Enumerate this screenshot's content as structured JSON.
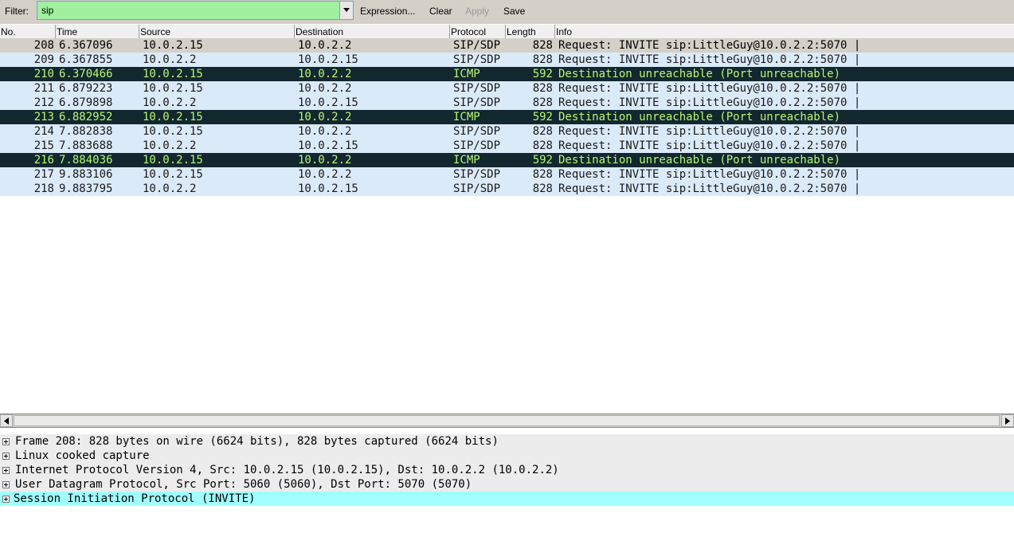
{
  "filter": {
    "label": "Filter:",
    "value": "sip",
    "expression_label": "Expression...",
    "clear_label": "Clear",
    "apply_label": "Apply",
    "save_label": "Save",
    "box_color": "#a0f0a0"
  },
  "columns": [
    "No.",
    "Time",
    "Source",
    "Destination",
    "Protocol",
    "Length",
    "Info"
  ],
  "packets": [
    {
      "no": "208",
      "time": "6.367096",
      "src": "10.0.2.15",
      "dst": "10.0.2.2",
      "proto": "SIP/SDP",
      "len": "828",
      "info": "Request: INVITE sip:LittleGuy@10.0.2.2:5070 |",
      "style": "selected"
    },
    {
      "no": "209",
      "time": "6.367855",
      "src": "10.0.2.2",
      "dst": "10.0.2.15",
      "proto": "SIP/SDP",
      "len": "828",
      "info": "Request: INVITE sip:LittleGuy@10.0.2.2:5070 |",
      "style": "sip"
    },
    {
      "no": "210",
      "time": "6.370466",
      "src": "10.0.2.15",
      "dst": "10.0.2.2",
      "proto": "ICMP",
      "len": "592",
      "info": "Destination unreachable (Port unreachable)",
      "style": "icmp"
    },
    {
      "no": "211",
      "time": "6.879223",
      "src": "10.0.2.15",
      "dst": "10.0.2.2",
      "proto": "SIP/SDP",
      "len": "828",
      "info": "Request: INVITE sip:LittleGuy@10.0.2.2:5070 |",
      "style": "sip"
    },
    {
      "no": "212",
      "time": "6.879898",
      "src": "10.0.2.2",
      "dst": "10.0.2.15",
      "proto": "SIP/SDP",
      "len": "828",
      "info": "Request: INVITE sip:LittleGuy@10.0.2.2:5070 |",
      "style": "sip"
    },
    {
      "no": "213",
      "time": "6.882952",
      "src": "10.0.2.15",
      "dst": "10.0.2.2",
      "proto": "ICMP",
      "len": "592",
      "info": "Destination unreachable (Port unreachable)",
      "style": "icmp"
    },
    {
      "no": "214",
      "time": "7.882838",
      "src": "10.0.2.15",
      "dst": "10.0.2.2",
      "proto": "SIP/SDP",
      "len": "828",
      "info": "Request: INVITE sip:LittleGuy@10.0.2.2:5070 |",
      "style": "sip"
    },
    {
      "no": "215",
      "time": "7.883688",
      "src": "10.0.2.2",
      "dst": "10.0.2.15",
      "proto": "SIP/SDP",
      "len": "828",
      "info": "Request: INVITE sip:LittleGuy@10.0.2.2:5070 |",
      "style": "sip"
    },
    {
      "no": "216",
      "time": "7.884036",
      "src": "10.0.2.15",
      "dst": "10.0.2.2",
      "proto": "ICMP",
      "len": "592",
      "info": "Destination unreachable (Port unreachable)",
      "style": "icmp"
    },
    {
      "no": "217",
      "time": "9.883106",
      "src": "10.0.2.15",
      "dst": "10.0.2.2",
      "proto": "SIP/SDP",
      "len": "828",
      "info": "Request: INVITE sip:LittleGuy@10.0.2.2:5070 |",
      "style": "sip"
    },
    {
      "no": "218",
      "time": "9.883795",
      "src": "10.0.2.2",
      "dst": "10.0.2.15",
      "proto": "SIP/SDP",
      "len": "828",
      "info": "Request: INVITE sip:LittleGuy@10.0.2.2:5070 |",
      "style": "sip"
    }
  ],
  "details": [
    {
      "text": "Frame 208: 828 bytes on wire (6624 bits), 828 bytes captured (6624 bits)"
    },
    {
      "text": "Linux cooked capture"
    },
    {
      "text": "Internet Protocol Version 4, Src: 10.0.2.15 (10.0.2.15), Dst: 10.0.2.2 (10.0.2.2)"
    },
    {
      "text": "User Datagram Protocol, Src Port: 5060 (5060), Dst Port: 5070 (5070)"
    },
    {
      "text": "Session Initiation Protocol (INVITE)",
      "highlight": true
    }
  ],
  "icons": {
    "filter_dropdown": "chevron-down-icon",
    "scroll_left": "arrow-left-icon",
    "scroll_right": "arrow-right-icon",
    "tree_expander": "plus-box-icon"
  },
  "colors": {
    "selected_row": "#d4d0c8",
    "sip_row": "#dbeaf8",
    "icmp_row_bg": "#12272e",
    "icmp_row_fg": "#b7f774",
    "highlight_detail": "#a0ffff"
  }
}
